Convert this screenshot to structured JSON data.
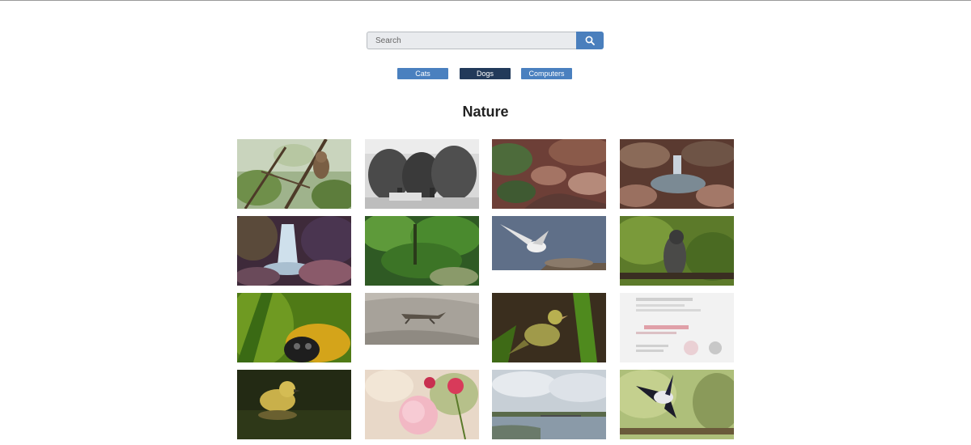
{
  "search": {
    "placeholder": "Search",
    "button_icon": "search-icon"
  },
  "categories": [
    {
      "label": "Cats",
      "selected": false
    },
    {
      "label": "Dogs",
      "selected": true
    },
    {
      "label": "Computers",
      "selected": false
    }
  ],
  "section_title": "Nature",
  "colors": {
    "accent": "#4a80bf",
    "selected": "#223a5a"
  },
  "gallery": [
    {
      "subject": "owl perched in leafy tree"
    },
    {
      "subject": "three elephants black and white"
    },
    {
      "subject": "rocky stream"
    },
    {
      "subject": "rocky waterfall pool"
    },
    {
      "subject": "waterfall over purple rocks"
    },
    {
      "subject": "green forest"
    },
    {
      "subject": "osprey landing on nest"
    },
    {
      "subject": "hawk perched on branch"
    },
    {
      "subject": "bumblebee close-up"
    },
    {
      "subject": "lizard on rock"
    },
    {
      "subject": "small yellow bird"
    },
    {
      "subject": "blurred document"
    },
    {
      "subject": "duckling in water"
    },
    {
      "subject": "pink roses"
    },
    {
      "subject": "lake under cloudy sky"
    },
    {
      "subject": "magpie in flight"
    }
  ]
}
